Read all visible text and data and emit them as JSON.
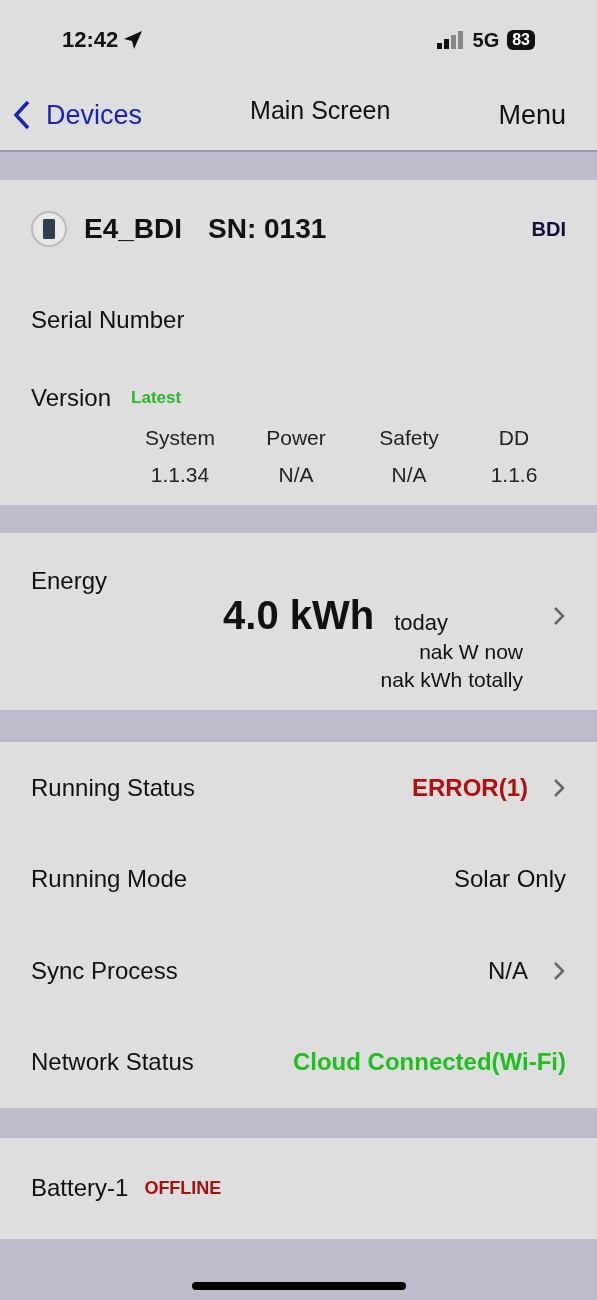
{
  "status_bar": {
    "time": "12:42",
    "network": "5G",
    "battery": "83"
  },
  "nav": {
    "back": "Devices",
    "title": "Main Screen",
    "menu": "Menu"
  },
  "device": {
    "name": "E4_BDI",
    "sn": "SN: 0131",
    "brand": "BDI",
    "serial_label": "Serial Number",
    "version_label": "Version",
    "version_badge": "Latest",
    "versions": [
      {
        "name": "System",
        "value": "1.1.34"
      },
      {
        "name": "Power",
        "value": "N/A"
      },
      {
        "name": "Safety",
        "value": "N/A"
      },
      {
        "name": "DD",
        "value": "1.1.6"
      }
    ]
  },
  "energy": {
    "label": "Energy",
    "today_value": "4.0 kWh",
    "today_unit": "today",
    "now": "nak W now",
    "total": "nak kWh totally"
  },
  "status_rows": [
    {
      "label": "Running Status",
      "value": "ERROR(1)",
      "color": "#b01010",
      "chevron": true
    },
    {
      "label": "Running Mode",
      "value": "Solar Only",
      "color": "#111111",
      "chevron": false
    },
    {
      "label": "Sync Process",
      "value": "N/A",
      "color": "#111111",
      "chevron": true
    },
    {
      "label": "Network Status",
      "value": "Cloud Connected(Wi-Fi)",
      "color": "#1fbf1f",
      "chevron": false
    }
  ],
  "battery": {
    "label": "Battery-1",
    "status": "OFFLINE"
  }
}
